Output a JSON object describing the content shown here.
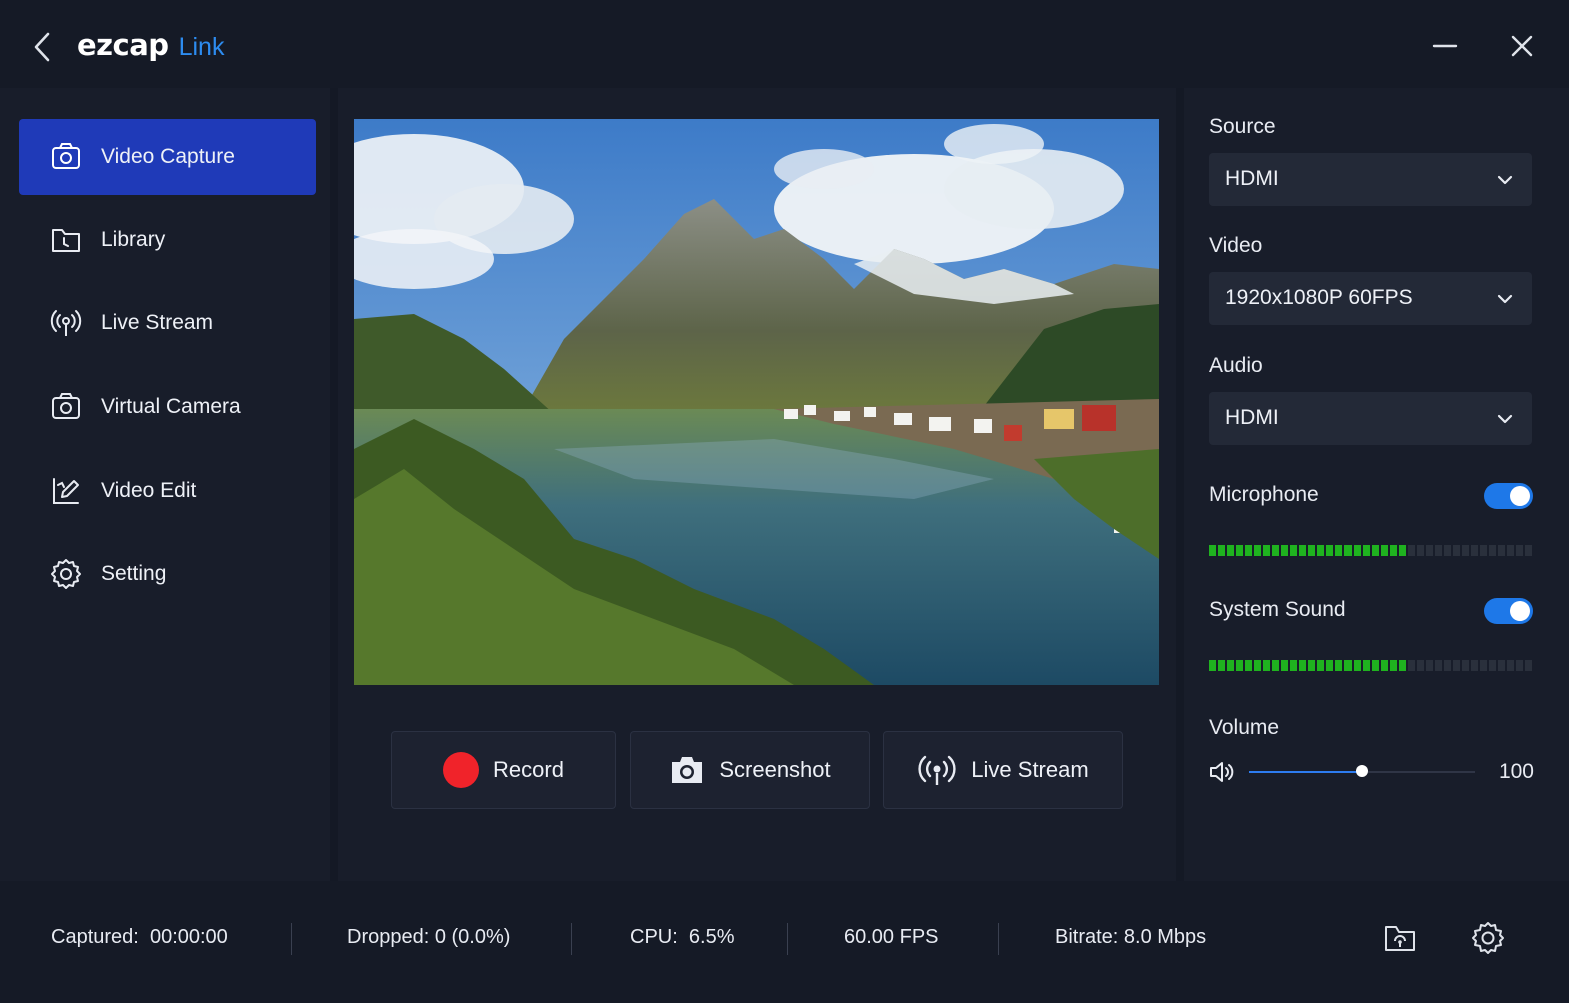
{
  "app": {
    "logo_main": "ezcap",
    "logo_sub": "Link"
  },
  "sidebar": {
    "items": [
      {
        "label": "Video Capture",
        "icon": "camera-icon",
        "active": true
      },
      {
        "label": "Library",
        "icon": "folder-icon"
      },
      {
        "label": "Live Stream",
        "icon": "broadcast-icon"
      },
      {
        "label": "Virtual Camera",
        "icon": "camera-icon"
      },
      {
        "label": "Video Edit",
        "icon": "edit-icon"
      },
      {
        "label": "Setting",
        "icon": "gear-icon"
      }
    ]
  },
  "controls": {
    "record_label": "Record",
    "screenshot_label": "Screenshot",
    "livestream_label": "Live Stream"
  },
  "settings": {
    "source_label": "Source",
    "source_value": "HDMI",
    "video_label": "Video",
    "video_value": "1920x1080P 60FPS",
    "audio_label": "Audio",
    "audio_value": "HDMI",
    "microphone_label": "Microphone",
    "microphone_on": true,
    "microphone_level": 0.62,
    "system_sound_label": "System Sound",
    "system_sound_on": true,
    "system_sound_level": 0.62,
    "volume_label": "Volume",
    "volume_value": "100",
    "volume_slider_fraction": 0.5
  },
  "status": {
    "captured": "Captured:  00:00:00",
    "dropped": "Dropped: 0 (0.0%)",
    "cpu": "CPU:  6.5%",
    "fps": "60.00 FPS",
    "bitrate": "Bitrate: 8.0 Mbps"
  },
  "colors": {
    "accent": "#1f3ab8",
    "toggle": "#1e78e8",
    "record": "#f0232a",
    "meter_on": "#1fb21f",
    "meter_off": "#2a303c"
  }
}
